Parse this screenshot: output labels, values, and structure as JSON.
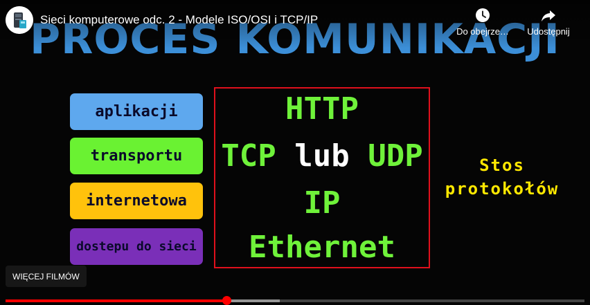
{
  "player": {
    "video_title": "Sieci komputerowe odc. 2 - Modele ISO/OSI i TCP/IP",
    "watch_later_label": "Do obejrze…",
    "share_label": "Udostępnij",
    "more_videos_label": "WIĘCEJ FILMÓW",
    "progress_fraction": 0.382,
    "buffer_fraction": 0.474,
    "accent_color": "#ff0000",
    "icons": {
      "watch_later": "clock-icon",
      "share": "share-arrow-icon",
      "channel": "channel-avatar"
    }
  },
  "slide": {
    "title": "PROCES KOMUNIKACJI",
    "layers": [
      {
        "label": "aplikacji",
        "color": "#5ea8ee"
      },
      {
        "label": "transportu",
        "color": "#6af232"
      },
      {
        "label": "internetowa",
        "color": "#ffc20c"
      },
      {
        "label": "dostepu do sieci",
        "color": "#7a2fb8"
      }
    ],
    "protocols": {
      "application": "HTTP",
      "transport_tcp": "TCP",
      "transport_or": "lub",
      "transport_udp": "UDP",
      "internet": "IP",
      "access": "Ethernet"
    },
    "stack_label_line1": "Stos",
    "stack_label_line2": "protokołów",
    "colors": {
      "title": "#3c8fd8",
      "protocol_text": "#6ff23a",
      "box_border": "#e0101c",
      "stack_label": "#ffe800"
    }
  }
}
